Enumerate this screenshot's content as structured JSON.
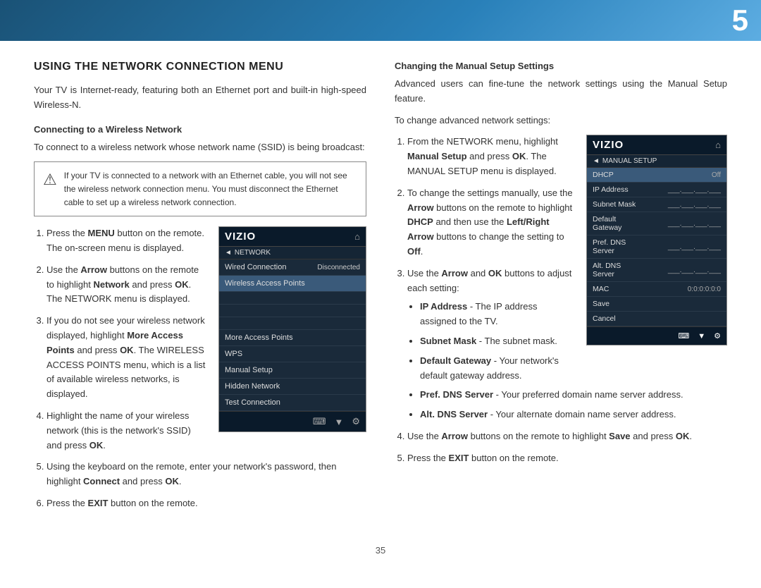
{
  "topbar": {
    "number": "5"
  },
  "page": {
    "title": "USING THE NETWORK CONNECTION MENU",
    "intro": "Your TV is Internet-ready, featuring both an Ethernet port and built-in high-speed Wireless-N.",
    "connecting_title": "Connecting to a Wireless Network",
    "connecting_intro": "To connect to a wireless network whose network name (SSID) is being broadcast:",
    "warning_text": "If your TV is connected to a network with an Ethernet cable, you will not see the wireless network connection menu. You must disconnect the Ethernet cable to set up a wireless network connection.",
    "steps_left": [
      {
        "id": 1,
        "text": "Press the MENU button on the remote. The on-screen menu is displayed.",
        "bold_parts": [
          "MENU"
        ]
      },
      {
        "id": 2,
        "text": "Use the Arrow buttons on the remote to highlight Network and press OK. The NETWORK menu is displayed.",
        "bold_parts": [
          "Arrow",
          "Network",
          "OK"
        ]
      },
      {
        "id": 3,
        "text": "If you do not see your wireless network displayed, highlight More Access Points and press OK. The WIRELESS ACCESS POINTS menu, which is a list of available wireless networks, is displayed.",
        "bold_parts": [
          "More Access Points",
          "OK"
        ]
      },
      {
        "id": 4,
        "text": "Highlight the name of your wireless network (this is the network’s SSID) and press OK.",
        "bold_parts": [
          "OK"
        ]
      },
      {
        "id": 5,
        "text": "Using the keyboard on the remote, enter your network’s password, then highlight Connect and press OK.",
        "bold_parts": [
          "Connect",
          "OK"
        ]
      },
      {
        "id": 6,
        "text": "Press the EXIT button on the remote.",
        "bold_parts": [
          "EXIT"
        ]
      }
    ],
    "right_col": {
      "manual_setup_title": "Changing the Manual Setup Settings",
      "manual_setup_intro": "Advanced users can fine-tune the network settings using the Manual Setup feature.",
      "change_intro": "To change advanced network settings:",
      "steps_right": [
        {
          "id": 1,
          "text": "From the NETWORK menu, highlight Manual Setup and press OK. The MANUAL SETUP menu is displayed.",
          "bold_parts": [
            "Manual Setup",
            "OK"
          ]
        },
        {
          "id": 2,
          "text": "To change the settings manually, use the Arrow buttons on the remote to highlight DHCP and then use the Left/Right Arrow buttons to change the setting to Off.",
          "bold_parts": [
            "Arrow",
            "DHCP",
            "Left/Right Arrow",
            "Off"
          ]
        },
        {
          "id": 3,
          "text": "Use the Arrow and OK buttons to adjust each setting:",
          "bold_parts": [
            "Arrow",
            "OK"
          ]
        },
        {
          "id": 4,
          "text": "Use the Arrow buttons on the remote to highlight Save and press OK.",
          "bold_parts": [
            "Arrow",
            "Save",
            "OK"
          ]
        },
        {
          "id": 5,
          "text": "Press the EXIT button on the remote.",
          "bold_parts": [
            "EXIT"
          ]
        }
      ],
      "bullets": [
        {
          "label": "IP Address",
          "text": " - The IP address assigned to the TV."
        },
        {
          "label": "Subnet Mask",
          "text": " - The subnet mask."
        },
        {
          "label": "Default Gateway",
          "text": " - Your network’s default gateway address."
        },
        {
          "label": "Pref. DNS Server",
          "text": " - Your preferred domain name server address."
        },
        {
          "label": "Alt. DNS Server",
          "text": " - Your alternate domain name server address."
        }
      ]
    }
  },
  "vizio_menu": {
    "logo": "VIZIO",
    "submenu": "NETWORK",
    "rows": [
      {
        "label": "Wired Connection",
        "value": "Disconnected"
      },
      {
        "label": "Wireless Access Points",
        "value": ""
      },
      {
        "label": "",
        "value": ""
      },
      {
        "label": "",
        "value": ""
      },
      {
        "label": "",
        "value": ""
      },
      {
        "label": "More Access Points",
        "value": ""
      },
      {
        "label": "WPS",
        "value": ""
      },
      {
        "label": "Manual Setup",
        "value": ""
      },
      {
        "label": "Hidden Network",
        "value": ""
      },
      {
        "label": "Test Connection",
        "value": ""
      }
    ]
  },
  "manual_menu": {
    "logo": "VIZIO",
    "submenu": "MANUAL SETUP",
    "rows": [
      {
        "label": "DHCP",
        "value": "Off",
        "highlight": true
      },
      {
        "label": "IP Address",
        "value": "___.___.___.___"
      },
      {
        "label": "Subnet Mask",
        "value": "___.___.___.___"
      },
      {
        "label": "Default Gateway",
        "value": "___.___.___.___"
      },
      {
        "label": "Pref. DNS Server",
        "value": "___.___.___.___"
      },
      {
        "label": "Alt. DNS Server",
        "value": "___.___.___.___"
      },
      {
        "label": "MAC",
        "value": "0:0:0:0:0:0"
      },
      {
        "label": "Save",
        "value": ""
      },
      {
        "label": "Cancel",
        "value": ""
      }
    ]
  },
  "footer": {
    "page_number": "35"
  }
}
